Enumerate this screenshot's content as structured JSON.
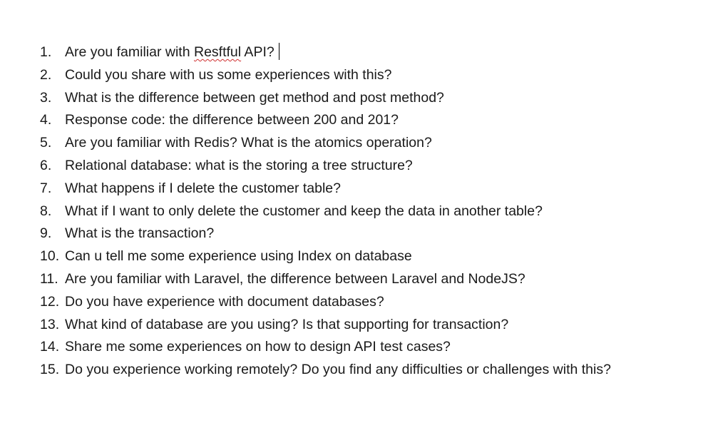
{
  "document": {
    "items": [
      {
        "num": "1.",
        "text_before": "Are you familiar with ",
        "misspelled": "Resftful",
        "text_after": " API?"
      },
      {
        "num": "2.",
        "text": "Could you share with us some experiences with this?"
      },
      {
        "num": "3.",
        "text": "What is the difference between get method and post method?"
      },
      {
        "num": "4.",
        "text": "Response code: the difference between 200 and 201?"
      },
      {
        "num": "5.",
        "text": "Are you familiar with Redis? What is the atomics operation?"
      },
      {
        "num": "6.",
        "text": "Relational database: what is the storing a tree structure?"
      },
      {
        "num": "7.",
        "text": "What happens if I delete the customer table?"
      },
      {
        "num": "8.",
        "text": "What if I want to only delete the customer and keep the data in another table?"
      },
      {
        "num": "9.",
        "text": "What is the transaction?"
      },
      {
        "num": "10.",
        "text": "Can u tell me some experience using Index on database"
      },
      {
        "num": "11.",
        "text": "Are you familiar with Laravel, the difference between Laravel and NodeJS?"
      },
      {
        "num": "12.",
        "text": "Do you have experience with document databases?"
      },
      {
        "num": "13.",
        "text": "What kind of database are you using? Is that supporting for transaction?"
      },
      {
        "num": "14.",
        "text": "Share me some experiences on how to design API test cases?"
      },
      {
        "num": "15.",
        "text": "Do you experience working remotely? Do you find any difficulties or challenges with this?"
      }
    ]
  }
}
